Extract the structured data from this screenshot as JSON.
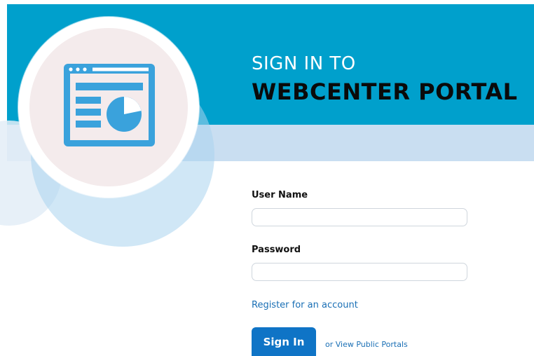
{
  "hero": {
    "title_line1": "SIGN IN TO",
    "title_line2": "WEBCENTER PORTAL",
    "icon": "dashboard-window-icon"
  },
  "form": {
    "username_label": "User Name",
    "username_value": "",
    "password_label": "Password",
    "password_value": "",
    "register_link": "Register for an account",
    "signin_button": "Sign In",
    "public_portals_link": "or View Public Portals"
  },
  "colors": {
    "header_blue": "#00a0cc",
    "subband_blue": "#c9def1",
    "button_blue": "#0f74c6",
    "link_blue": "#1a6fb5"
  }
}
